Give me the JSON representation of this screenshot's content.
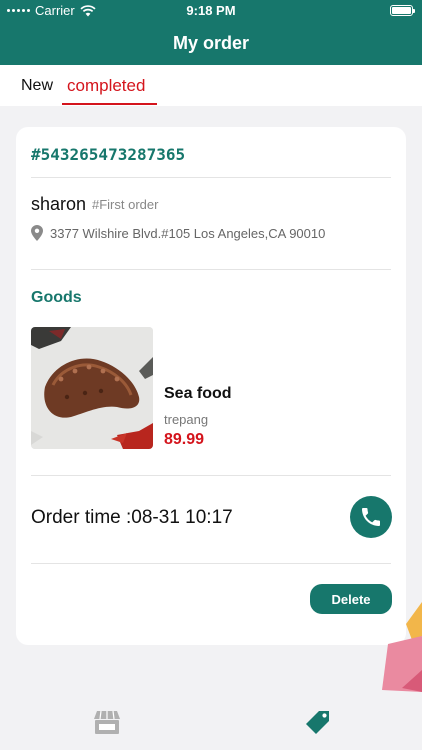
{
  "status_bar": {
    "carrier": "Carrier",
    "time": "9:18 PM"
  },
  "header": {
    "title": "My order"
  },
  "tabs": [
    {
      "label": "New",
      "active": false
    },
    {
      "label": "completed",
      "active": true
    }
  ],
  "order": {
    "number": "#543265473287365",
    "customer_name": "sharon",
    "order_tag": "#First order",
    "address": "3377 Wilshire Blvd.#105 Los Angeles,CA 90010",
    "goods_title": "Goods",
    "product": {
      "name": "Sea food",
      "type": "trepang",
      "price": "89.99"
    },
    "order_time": "Order time :08-31 10:17",
    "delete_label": "Delete"
  },
  "tabbar": [
    {
      "icon": "store-icon",
      "active": false
    },
    {
      "icon": "tag-icon",
      "active": true
    }
  ],
  "colors": {
    "primary": "#17776c",
    "accent_red": "#d4141c",
    "inactive": "#b0b0b0"
  }
}
